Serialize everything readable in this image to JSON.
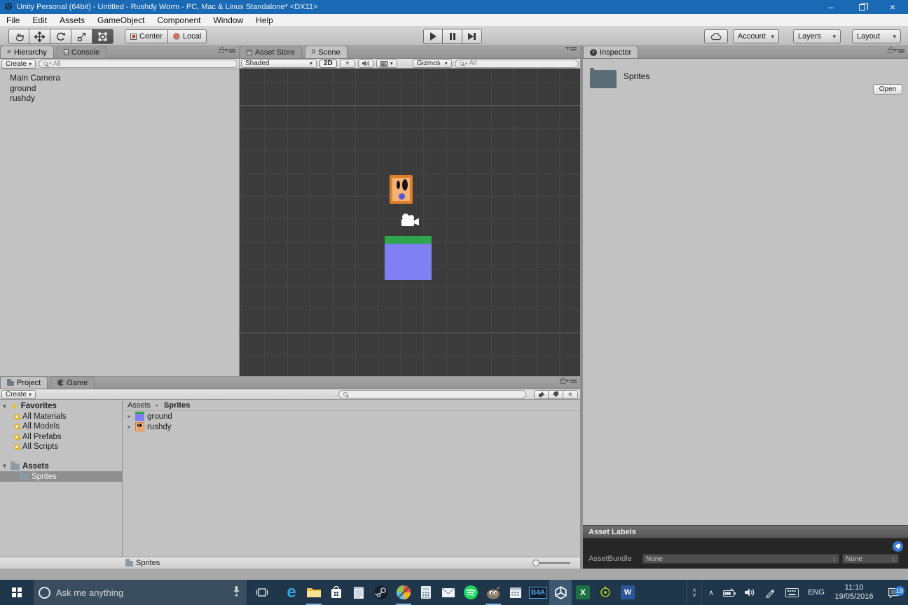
{
  "window": {
    "title": "Unity Personal (64bit) - Untitled - Rushdy Worm - PC, Mac & Linux Standalone* <DX11>"
  },
  "glyphs": {
    "minimize": "–",
    "close": "×",
    "caret": "▾",
    "expander_open": "▼",
    "expander_closed": "▸",
    "breadcrumb_sep": "▸",
    "sun": "☀",
    "star": "★",
    "updown": "↕",
    "info_i": "i",
    "hierarchy_icon": "≡",
    "scene_grid": "#",
    "edge": "e",
    "excel": "X",
    "word": "W",
    "b4a": "B4A"
  },
  "menubar": {
    "items": [
      "File",
      "Edit",
      "Assets",
      "GameObject",
      "Component",
      "Window",
      "Help"
    ]
  },
  "toolbar": {
    "center": "Center",
    "local": "Local",
    "account": "Account",
    "layers": "Layers",
    "layout": "Layout"
  },
  "hierarchy": {
    "tab": "Hierarchy",
    "console_tab": "Console",
    "create": "Create",
    "search_text": "All",
    "items": [
      "Main Camera",
      "ground",
      "rushdy"
    ]
  },
  "scene": {
    "store_tab": "Asset Store",
    "tab": "Scene",
    "shaded": "Shaded",
    "mode_2d": "2D",
    "gizmos": "Gizmos",
    "search_text": "All"
  },
  "inspector": {
    "tab": "Inspector",
    "title": "Sprites",
    "open": "Open",
    "asset_labels": "Asset Labels",
    "assetbundle": "AssetBundle",
    "bundle_value": "None",
    "variant_value": "None"
  },
  "project": {
    "tab": "Project",
    "game_tab": "Game",
    "create": "Create",
    "favorites": "Favorites",
    "favorite_items": [
      "All Materials",
      "All Models",
      "All Prefabs",
      "All Scripts"
    ],
    "assets": "Assets",
    "assets_child": "Sprites",
    "breadcrumb": [
      "Assets",
      "Sprites"
    ],
    "items": [
      "ground",
      "rushdy"
    ],
    "status": "Sprites"
  },
  "taskbar": {
    "search_placeholder": "Ask me anything",
    "language": "ENG",
    "time": "11:10",
    "date": "19/05/2016",
    "notification_count": "19"
  },
  "colors": {
    "titlebar_blue": "#1a69b4",
    "taskbar": "#20364a",
    "panel": "#c2c2c2",
    "scene_bg": "#3b3b3b",
    "selection": "#8f8f8f",
    "ground_green": "#2fa54e",
    "ground_purple": "#8080f2",
    "rushdy_border": "#df7d28",
    "rushdy_fill": "#f3b278",
    "rushdy_mouth": "#5f57c9",
    "tag_blue": "#3a7bd5",
    "running_underline": "#79b7e6"
  }
}
